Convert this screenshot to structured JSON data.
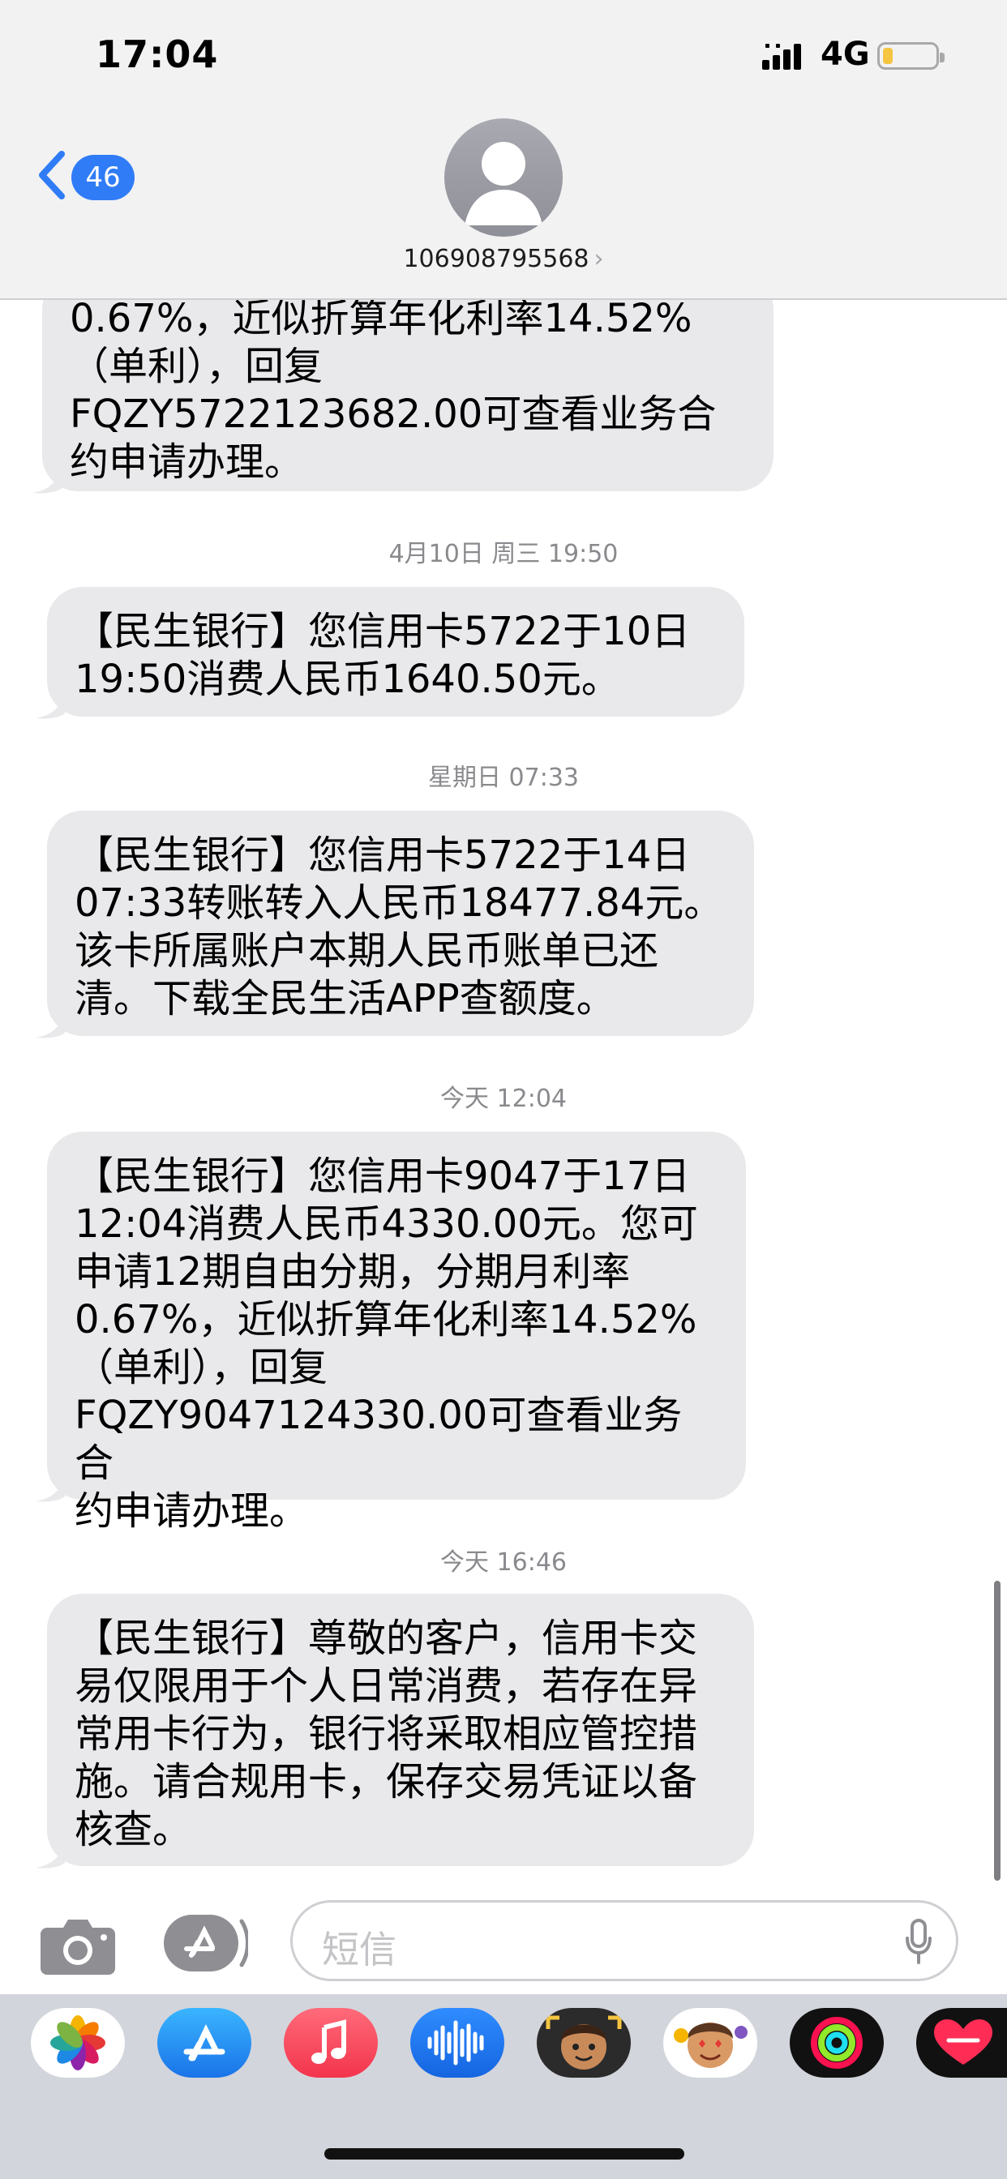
{
  "status_bar": {
    "time": "17:04",
    "network": "4G",
    "battery_level": 0.2
  },
  "header": {
    "back_count": "46",
    "contact_number": "106908795568",
    "contact_chevron": "›"
  },
  "colors": {
    "accent": "#2f7cf6",
    "bubble": "#e9e9eb",
    "header_bg": "#f2f2f3"
  },
  "messages": [
    {
      "type": "bubble",
      "text": "0.67%，近似折算年化利率14.52%\n（单利），回复\nFQZY5722123682.00可查看业务合\n约申请办理。"
    },
    {
      "type": "timestamp",
      "text": "4月10日 周三 19:50"
    },
    {
      "type": "bubble",
      "text": "【民生银行】您信用卡5722于10日\n19:50消费人民币1640.50元。"
    },
    {
      "type": "timestamp",
      "text": "星期日 07:33"
    },
    {
      "type": "bubble",
      "text": "【民生银行】您信用卡5722于14日\n07:33转账转入人民币18477.84元。\n该卡所属账户本期人民币账单已还\n清。下载全民生活APP查额度。"
    },
    {
      "type": "timestamp",
      "text": "今天 12:04"
    },
    {
      "type": "bubble",
      "text": "【民生银行】您信用卡9047于17日\n12:04消费人民币4330.00元。您可\n申请12期自由分期，分期月利率\n0.67%，近似折算年化利率14.52%\n（单利），回复\nFQZY9047124330.00可查看业务合\n约申请办理。"
    },
    {
      "type": "timestamp",
      "text": "今天 16:46"
    },
    {
      "type": "bubble",
      "text": "【民生银行】尊敬的客户，信用卡交\n易仅限用于个人日常消费，若存在异\n常用卡行为，银行将采取相应管控措\n施。请合规用卡，保存交易凭证以备\n核查。"
    }
  ],
  "input": {
    "placeholder": "短信"
  },
  "app_drawer": [
    {
      "name": "photos-app-icon"
    },
    {
      "name": "app-store-app-icon"
    },
    {
      "name": "music-app-icon"
    },
    {
      "name": "audio-messages-app-icon"
    },
    {
      "name": "memoji-app-icon"
    },
    {
      "name": "memoji-stickers-app-icon"
    },
    {
      "name": "activity-app-icon"
    },
    {
      "name": "digital-touch-app-icon"
    }
  ]
}
